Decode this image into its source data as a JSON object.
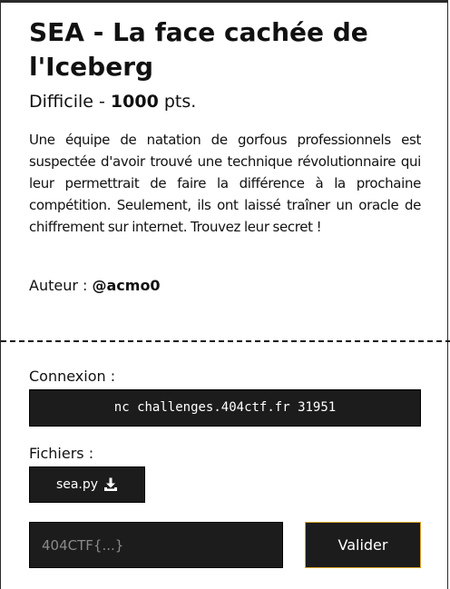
{
  "challenge": {
    "title": "SEA - La face cachée de l'Iceberg",
    "difficulty_label": "Difficile",
    "separator": " - ",
    "points_value": "1000",
    "points_unit": " pts.",
    "description": "Une équipe de natation de gorfous professionnels est suspectée d'avoir trouvé une technique révolutionnaire qui leur permettrait de faire la différence à la prochaine compétition. Seulement, ils ont laissé traîner un oracle de chiffrement sur internet. Trouvez leur secret !",
    "author_label": "Auteur : ",
    "author_handle": "@acmo0"
  },
  "connexion": {
    "label": "Connexion :",
    "command": "nc challenges.404ctf.fr 31951"
  },
  "files": {
    "label": "Fichiers :",
    "items": [
      {
        "name": "sea.py",
        "icon": "download-icon"
      }
    ]
  },
  "flag_form": {
    "placeholder": "404CTF{...}",
    "value": "",
    "submit_label": "Valider"
  },
  "colors": {
    "dark_box": "#1c1c1c",
    "submit_border": "#e0a32a",
    "text": "#111111"
  }
}
